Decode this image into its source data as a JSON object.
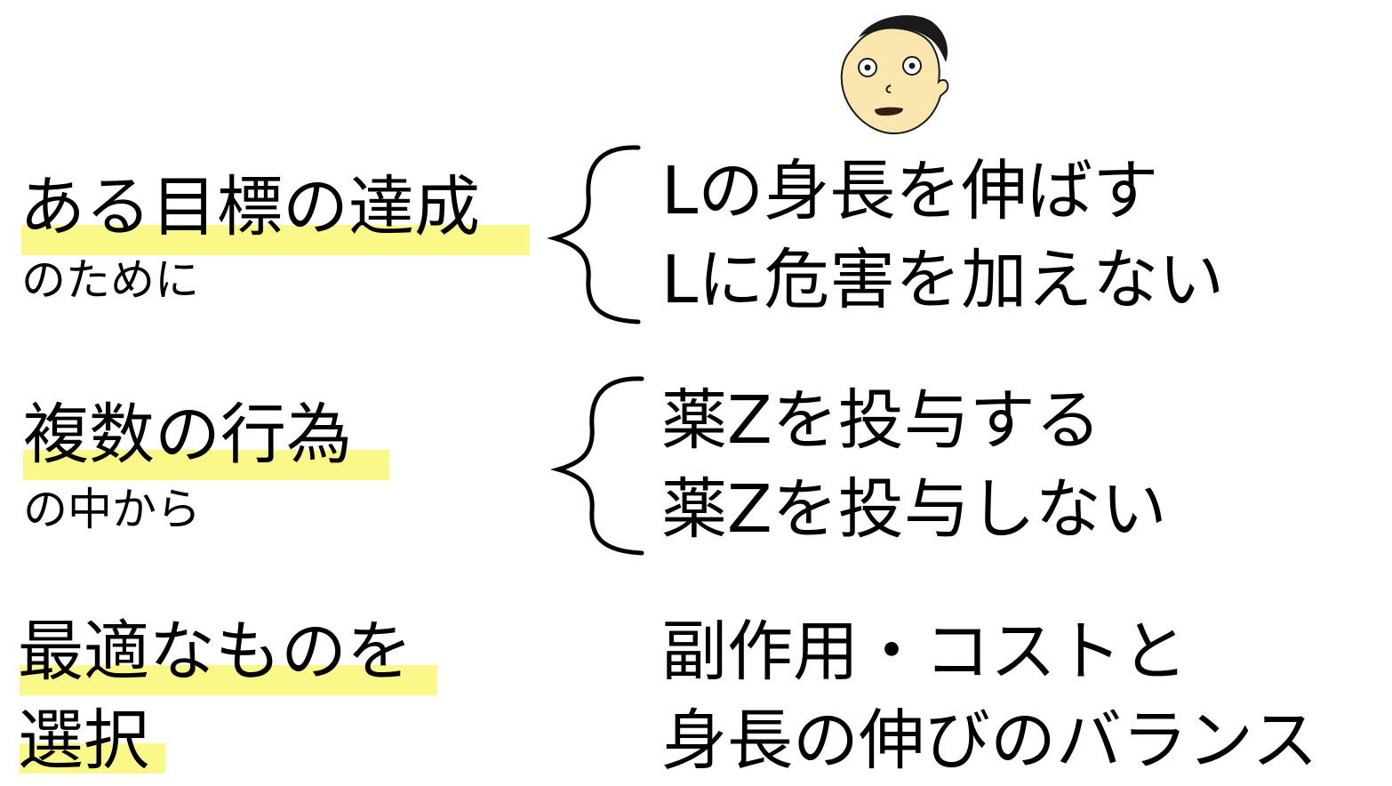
{
  "rows": [
    {
      "left_main": "ある目標の達成",
      "left_sub": "のために",
      "right_lines": [
        "Lの身長を伸ばす",
        "Lに危害を加えない"
      ]
    },
    {
      "left_main": "複数の行為",
      "left_sub": "の中から",
      "right_lines": [
        "薬Zを投与する",
        "薬Zを投与しない"
      ]
    },
    {
      "left_main_line1": "最適なものを",
      "left_main_line2": "選択",
      "right_lines": [
        "副作用・コストと",
        "身長の伸びのバランス"
      ]
    }
  ],
  "colors": {
    "highlight": "#fbf88a",
    "text": "#000000",
    "skin": "#fbe6b0",
    "hair": "#1a1a1a",
    "mouth": "#3b1a12"
  },
  "icons": {
    "character": "bald-face-icon",
    "brace": "left-curly-brace"
  }
}
